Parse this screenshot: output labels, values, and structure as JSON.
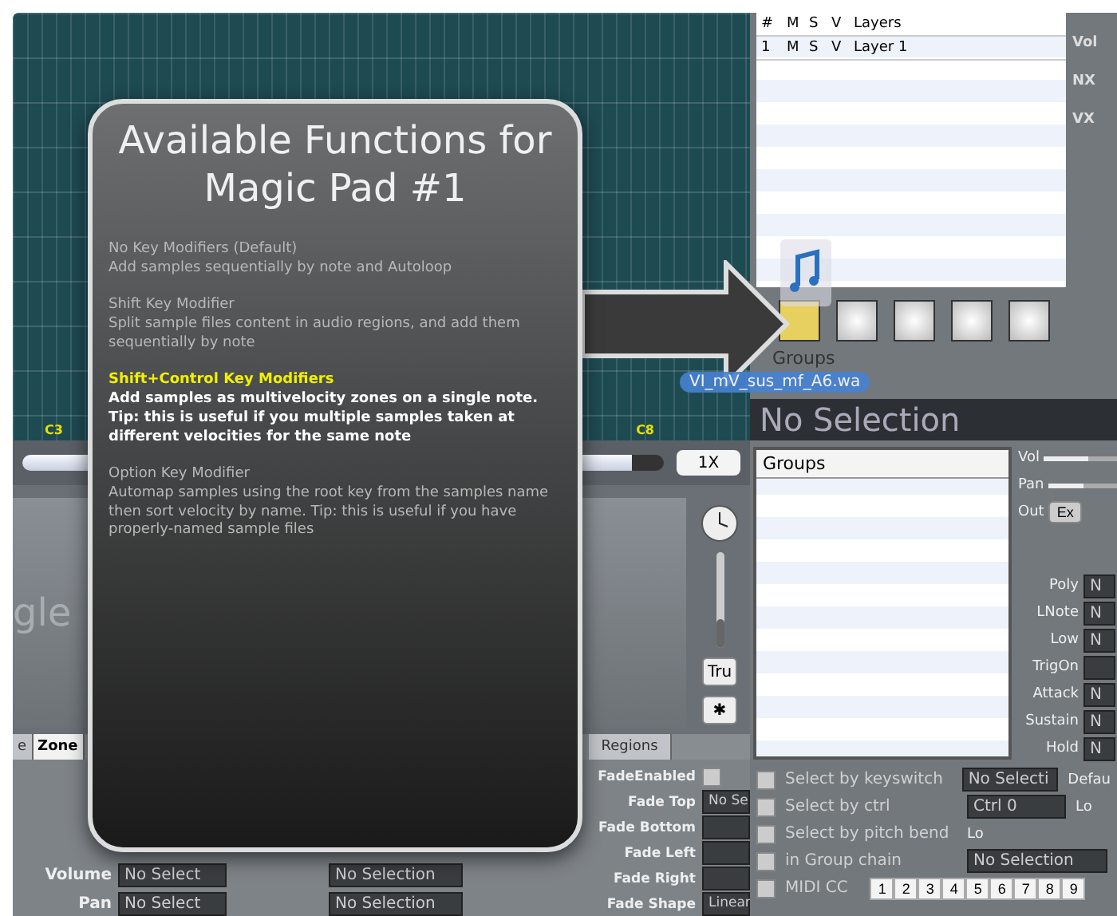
{
  "keyboard": {
    "keys": [
      {
        "label": "C3"
      },
      {
        "label": "C8"
      }
    ]
  },
  "zoom": {
    "value": "1X",
    "level": 0.95
  },
  "selection_panel": {
    "title": "gle",
    "buttons": [
      "Tru",
      "✱"
    ],
    "level": 0.3
  },
  "tabs": [
    {
      "label": "e",
      "selected": false
    },
    {
      "label": "Zone",
      "selected": true
    },
    {
      "label": "Regions",
      "selected": false
    }
  ],
  "zone_fields": [
    {
      "label": "Volume",
      "value": "No Select",
      "value_2": "No Selection"
    },
    {
      "label": "Pan",
      "value": "No Select",
      "value_2": "No Selection"
    }
  ],
  "fade_fields": [
    {
      "label": "FadeEnabled",
      "kind": "checkbox",
      "checked": false
    },
    {
      "label": "Fade Top",
      "kind": "field",
      "value": "No Se"
    },
    {
      "label": "Fade Bottom",
      "kind": "field"
    },
    {
      "label": "Fade Left",
      "kind": "field"
    },
    {
      "label": "Fade Right",
      "kind": "field"
    },
    {
      "label": "Fade Shape",
      "kind": "field",
      "value": "Linear"
    }
  ],
  "layers": {
    "columns": [
      "#",
      "M",
      "S",
      "V",
      "Layers"
    ],
    "rows": [
      {
        "number": "1",
        "m": "M",
        "s": "S",
        "v": "V",
        "name": "Layer 1"
      }
    ],
    "side_labels": [
      "Vol",
      "NX",
      "VX"
    ]
  },
  "pads": {
    "label": "Groups",
    "items": [
      {
        "filled": true
      },
      {
        "filled": false
      },
      {
        "filled": false
      },
      {
        "filled": false
      },
      {
        "filled": false
      }
    ]
  },
  "drag_file": "VI_mV_sus_mf_A6.wa",
  "group_header": "No Selection",
  "groups": {
    "title": "Groups"
  },
  "group_params": {
    "top": [
      {
        "label": "Vol",
        "kind": "slider",
        "level": 0.6
      },
      {
        "label": "Pan",
        "kind": "slider",
        "level": 0.5
      },
      {
        "label": "Out",
        "kind": "button",
        "value": "Ex"
      }
    ],
    "fields": [
      {
        "label": "Poly",
        "value": "N"
      },
      {
        "label": "LNote",
        "value": "N"
      },
      {
        "label": "Low",
        "value": "N"
      },
      {
        "label": "TrigOn"
      },
      {
        "label": "Attack",
        "value": "N"
      },
      {
        "label": "Sustain",
        "value": "N"
      },
      {
        "label": "Hold",
        "value": "N"
      }
    ]
  },
  "group_options": [
    {
      "label": "Select by keyswitch",
      "checked": false,
      "control": "No Selecti",
      "right": "Defau"
    },
    {
      "label": "Select by ctrl",
      "checked": false,
      "control": "Ctrl 0",
      "right": "Lo"
    },
    {
      "label": "Select by pitch bend",
      "checked": false,
      "right": "Lo"
    },
    {
      "label": "in Group chain",
      "checked": false,
      "control": "No Selection"
    },
    {
      "label": "MIDI CC",
      "checked": false
    }
  ],
  "channel_buttons": [
    "1",
    "2",
    "3",
    "4",
    "5",
    "6",
    "7",
    "8",
    "9"
  ],
  "popup": {
    "title": "Available Functions for Magic Pad #1",
    "items": [
      {
        "heading": "No Key Modifiers (Default)",
        "text": "Add samples sequentially by note and Autoloop",
        "selected": false
      },
      {
        "heading": "Shift Key Modifier",
        "text": "Split sample files content in audio regions, and add them sequentially by note",
        "selected": false
      },
      {
        "heading": "Shift+Control Key Modifiers",
        "text": "Add samples as multivelocity zones on a single note. Tip: this is useful if you multiple samples taken at different velocities for the same note",
        "selected": true
      },
      {
        "heading": "Option Key Modifier",
        "text": "Automap samples using the root key from the samples name then sort velocity by name. Tip: this is useful if you have properly-named sample files",
        "selected": false
      }
    ]
  }
}
